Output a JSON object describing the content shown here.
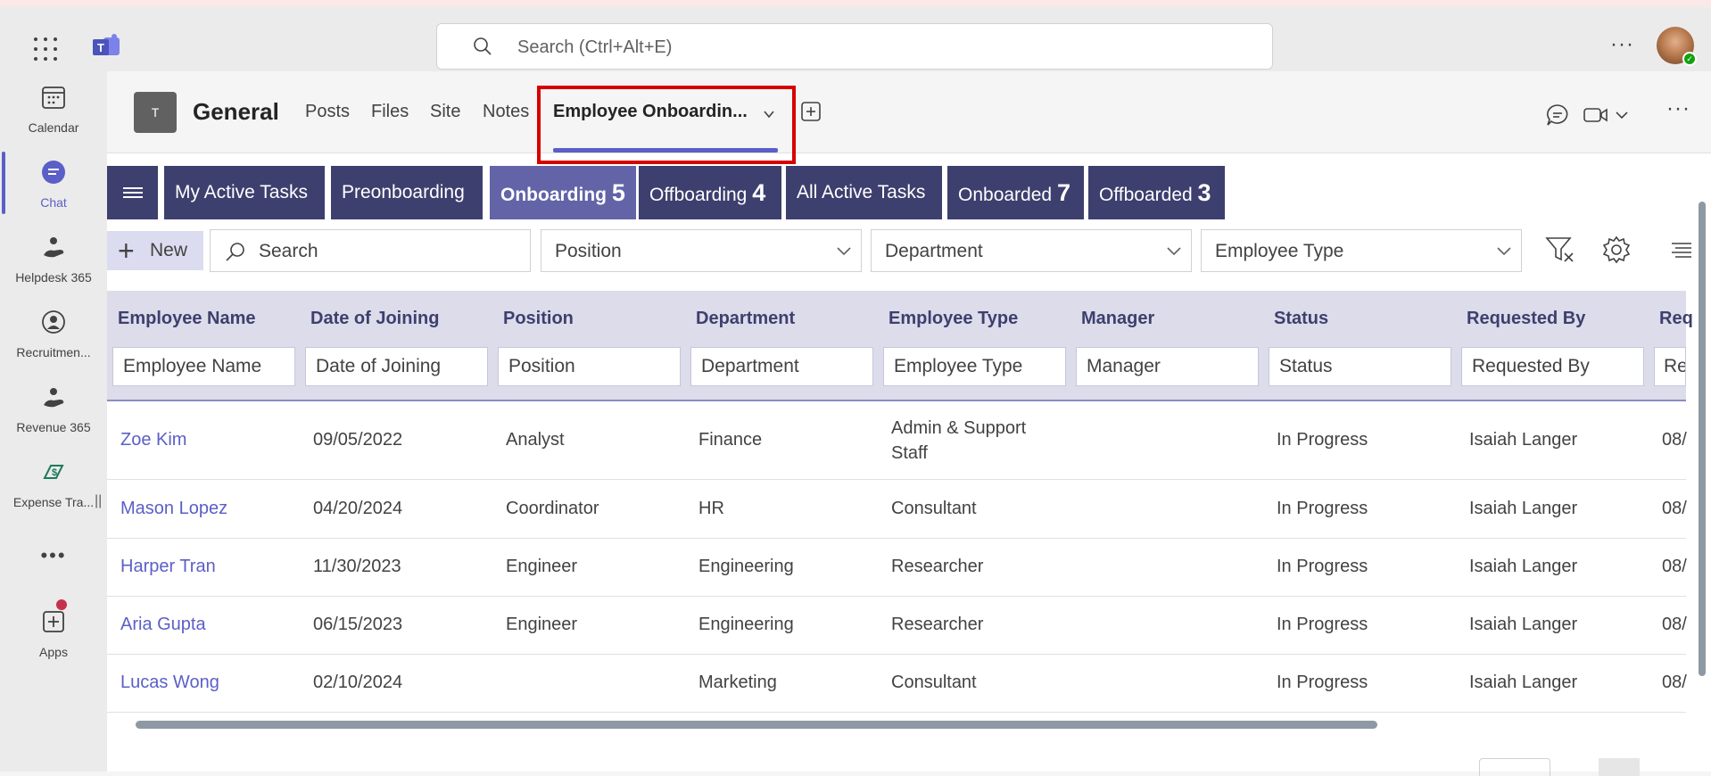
{
  "topbar": {
    "search_placeholder": "Search (Ctrl+Alt+E)",
    "more_label": "···"
  },
  "rail": {
    "items": [
      {
        "label": "Calendar",
        "icon": "calendar-icon"
      },
      {
        "label": "Chat",
        "icon": "chat-icon",
        "active": true
      },
      {
        "label": "Helpdesk 365",
        "icon": "helpdesk-icon"
      },
      {
        "label": "Recruitmen...",
        "icon": "recruitment-icon"
      },
      {
        "label": "Revenue 365",
        "icon": "revenue-icon"
      },
      {
        "label": "Expense Tra...",
        "icon": "expense-icon"
      },
      {
        "label": "Apps",
        "icon": "apps-icon"
      }
    ],
    "more_label": "•••"
  },
  "header": {
    "team_initial": "T",
    "channel": "General",
    "tabs": [
      "Posts",
      "Files",
      "Site",
      "Notes",
      "Employee Onboardin..."
    ]
  },
  "nav": {
    "items": [
      {
        "label": "My Active Tasks",
        "count": ""
      },
      {
        "label": "Preonboarding",
        "count": ""
      },
      {
        "label": "Onboarding",
        "count": "5",
        "active": true
      },
      {
        "label": "Offboarding",
        "count": "4"
      },
      {
        "label": "All Active Tasks",
        "count": ""
      },
      {
        "label": "Onboarded",
        "count": "7"
      },
      {
        "label": "Offboarded",
        "count": "3"
      }
    ]
  },
  "toolbar": {
    "new_label": "New",
    "search_label": "Search",
    "dropdowns": [
      "Position",
      "Department",
      "Employee Type"
    ]
  },
  "grid": {
    "columns": [
      "Employee Name",
      "Date of Joining",
      "Position",
      "Department",
      "Employee Type",
      "Manager",
      "Status",
      "Requested By",
      "Req"
    ],
    "filters": [
      "Employee Name",
      "Date of Joining",
      "Position",
      "Department",
      "Employee Type",
      "Manager",
      "Status",
      "Requested By",
      "Re"
    ],
    "rows": [
      {
        "name": "Zoe Kim",
        "doj": "09/05/2022",
        "position": "Analyst",
        "department": "Finance",
        "type": "Admin & Support Staff",
        "manager": "",
        "status": "In Progress",
        "requested_by": "Isaiah Langer",
        "extra": "08/"
      },
      {
        "name": "Mason Lopez",
        "doj": "04/20/2024",
        "position": "Coordinator",
        "department": "HR",
        "type": "Consultant",
        "manager": "",
        "status": "In Progress",
        "requested_by": "Isaiah Langer",
        "extra": "08/"
      },
      {
        "name": "Harper Tran",
        "doj": "11/30/2023",
        "position": "Engineer",
        "department": "Engineering",
        "type": "Researcher",
        "manager": "",
        "status": "In Progress",
        "requested_by": "Isaiah Langer",
        "extra": "08/"
      },
      {
        "name": "Aria Gupta",
        "doj": "06/15/2023",
        "position": "Engineer",
        "department": "Engineering",
        "type": "Researcher",
        "manager": "",
        "status": "In Progress",
        "requested_by": "Isaiah Langer",
        "extra": "08/"
      },
      {
        "name": "Lucas Wong",
        "doj": "02/10/2024",
        "position": "",
        "department": "Marketing",
        "type": "Consultant",
        "manager": "",
        "status": "In Progress",
        "requested_by": "Isaiah Langer",
        "extra": "08/"
      }
    ]
  },
  "colors": {
    "accent": "#5b5fc7",
    "nav_dark": "#3d3f6e",
    "nav_active": "#6264a7",
    "highlight": "#d60000"
  }
}
